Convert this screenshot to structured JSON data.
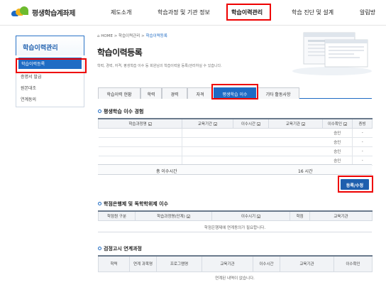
{
  "header": {
    "logo_text": "평생학습계좌제",
    "nav": [
      "제도소개",
      "학습과정 및 기관 정보",
      "학습이력관리",
      "학습 진단 및 설계",
      "알림방"
    ]
  },
  "sidebar": {
    "title": "학습이력관리",
    "items": [
      "학습이력등록",
      "증명서 발급",
      "원본대조",
      "연계동의"
    ]
  },
  "breadcrumb": {
    "home": "HOME",
    "sep": ">",
    "parent": "학습이력관리",
    "current": "학습이력등록"
  },
  "page": {
    "title": "학습이력등록",
    "desc": "학력, 경력, 자격, 평생학습 이수 등 회원님의 학습이력을 등록/관리하실 수 있습니다."
  },
  "tabs": [
    "학습이력 현황",
    "학력",
    "경력",
    "자격",
    "평생학습 이수",
    "기타 활동사항"
  ],
  "section1": {
    "title": "평생학습 이수 경험",
    "headers": [
      "학습과정명",
      "교육기간",
      "이수시간",
      "교육기관",
      "이수확인",
      "증빙"
    ],
    "rows": [
      [
        "",
        "",
        "",
        "",
        "승인",
        "-"
      ],
      [
        "",
        "",
        "",
        "",
        "승인",
        "-"
      ],
      [
        "",
        "",
        "",
        "",
        "승인",
        "-"
      ],
      [
        "",
        "",
        "",
        "",
        "승인",
        "-"
      ]
    ],
    "total_label": "총 이수시간",
    "total_value": "16 시간"
  },
  "register_button": "등록/수정",
  "section2": {
    "title": "학점은행제 및 독학학위제 이수",
    "headers": [
      "학점원 구분",
      "학습과정명(단계)",
      "이수시기",
      "학점",
      "교육기관"
    ],
    "empty": "학점은행제에 연계동의가 필요합니다."
  },
  "section3": {
    "title": "검정고시 연계과정",
    "headers": [
      "학력",
      "연계 과목명",
      "프로그램명",
      "교육기관",
      "이수시간",
      "교육기관",
      "이수확인"
    ],
    "empty": "연계된 내역이 없습니다."
  },
  "colors": {
    "primary": "#1e6bc4",
    "highlight": "#ee0000"
  }
}
